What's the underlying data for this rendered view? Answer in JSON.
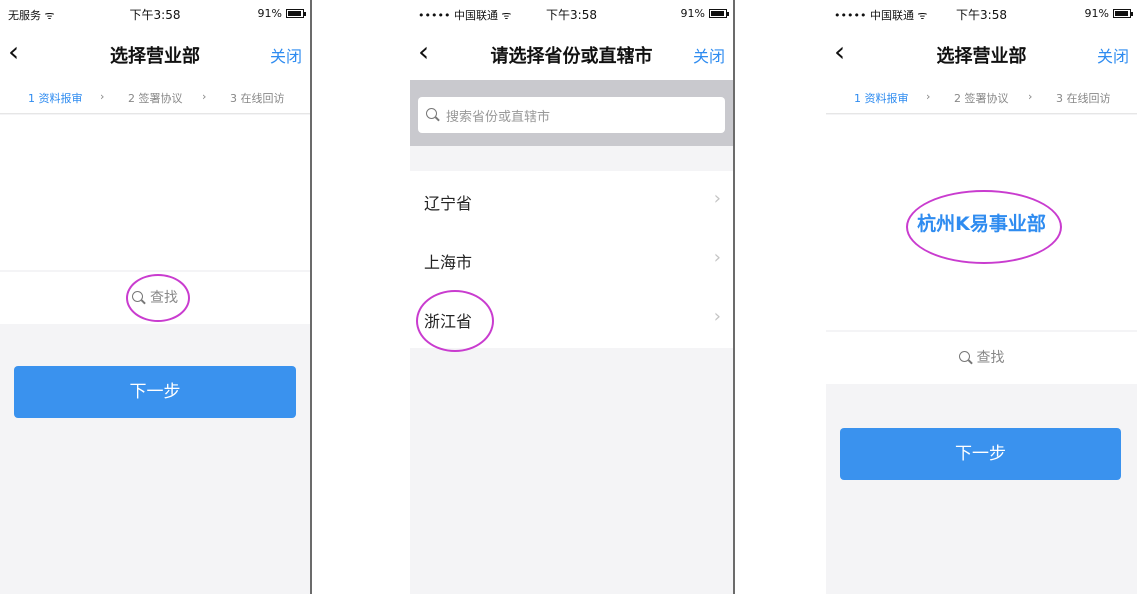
{
  "phone1": {
    "status": {
      "carrier": "无服务 ᯤ",
      "time": "下午3:58",
      "battery": "91%"
    },
    "nav": {
      "back": "‹",
      "title": "选择营业部",
      "close": "关闭"
    },
    "steps": [
      "1 资料报审",
      "›",
      "2 签署协议",
      "›",
      "3 在线回访"
    ],
    "search_label": "查找",
    "next_button": "下一步"
  },
  "phone2": {
    "status": {
      "carrier": "••••• 中国联通 ᯤ",
      "time": "下午3:58",
      "battery": "91%"
    },
    "nav": {
      "back": "‹",
      "title": "请选择省份或直辖市",
      "close": "关闭"
    },
    "search_placeholder": "搜索省份或直辖市",
    "provinces": [
      {
        "label": "辽宁省"
      },
      {
        "label": "上海市"
      },
      {
        "label": "浙江省"
      }
    ]
  },
  "phone3": {
    "status": {
      "carrier": "••••• 中国联通 ᯤ",
      "time": "下午3:58",
      "battery": "91%"
    },
    "nav": {
      "back": "‹",
      "title": "选择营业部",
      "close": "关闭"
    },
    "steps": [
      "1 资料报审",
      "›",
      "2 签署协议",
      "›",
      "3 在线回访"
    ],
    "selected_branch": "杭州K易事业部",
    "search_label": "查找",
    "next_button": "下一步"
  },
  "colors": {
    "accent": "#2f8cf0",
    "button": "#3a92ee",
    "highlight_ring": "#c93ccf"
  },
  "icons": {
    "back": "chevron-left-icon",
    "search": "search-icon",
    "chevron": "chevron-right-icon"
  }
}
